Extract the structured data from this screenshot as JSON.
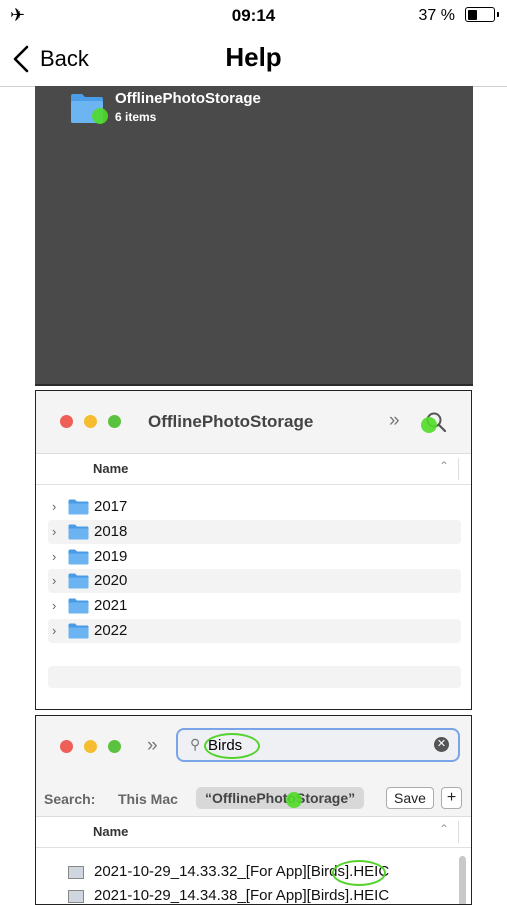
{
  "status_bar": {
    "time": "09:14",
    "battery_percent": "37 %",
    "battery_level": 0.37,
    "airplane_icon": "airplane-icon"
  },
  "nav": {
    "back_label": "Back",
    "title": "Help"
  },
  "folder_panel": {
    "folder_name": "OfflinePhotoStorage",
    "item_count": "6 items"
  },
  "finder_window": {
    "title": "OfflinePhotoStorage",
    "column_header": "Name",
    "more_icon": "»",
    "folders": [
      "2017",
      "2018",
      "2019",
      "2020",
      "2021",
      "2022"
    ]
  },
  "search_window": {
    "more_icon": "»",
    "search_value": "Birds",
    "scope_label": "Search:",
    "scope_this_mac": "This Mac",
    "scope_folder": "“OfflinePhotoStorage”",
    "save_label": "Save",
    "add_label": "+",
    "column_header": "Name",
    "results": [
      "2021-10-29_14.33.32_[For App][Birds].HEIC",
      "2021-10-29_14.34.38_[For App][Birds].HEIC"
    ]
  },
  "colors": {
    "highlight_green": "#55d22c",
    "search_focus": "#7aa4e8",
    "dark_panel": "#4a4a4a"
  }
}
